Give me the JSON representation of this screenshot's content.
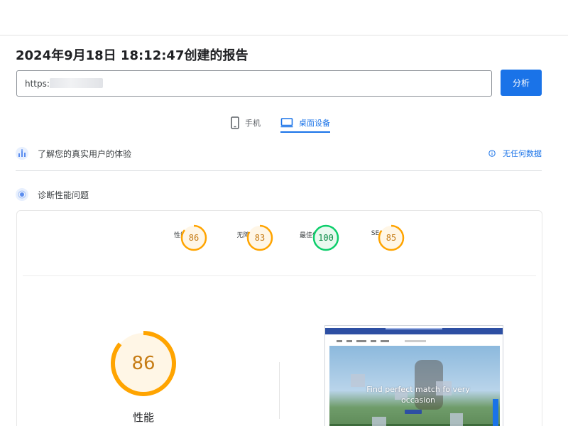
{
  "report": {
    "title": "2024年9月18日 18:12:47创建的报告"
  },
  "search": {
    "url_value": "https://          m/",
    "analyze_label": "分析"
  },
  "device_tabs": [
    {
      "label": "手机",
      "icon": "mobile-phone-icon",
      "active": false
    },
    {
      "label": "桌面设备",
      "icon": "desktop-monitor-icon",
      "active": true
    }
  ],
  "ux_section": {
    "label": "了解您的真实用户的体验",
    "icon": "crux-icon",
    "no_data_label": "无任何数据",
    "no_data_icon": "info-icon"
  },
  "diagnose_section": {
    "label": "诊断性能问题",
    "icon": "lighthouse-icon"
  },
  "scores": [
    {
      "value": "86",
      "label": "性能",
      "color": "#ffa400",
      "fraction": 0.86
    },
    {
      "value": "83",
      "label": "无障碍",
      "color": "#ffa400",
      "fraction": 0.83
    },
    {
      "value": "100",
      "label": "最佳做法",
      "color": "#0cce6b",
      "fraction": 1.0
    },
    {
      "value": "85",
      "label": "SEO",
      "color": "#ffa400",
      "fraction": 0.85
    }
  ],
  "main_score": {
    "value": "86",
    "label": "性能",
    "color": "#ffa400",
    "fraction": 0.86
  },
  "preview": {
    "headline": "Find   perfect   match fo  very occasion"
  },
  "colors": {
    "accent": "#1a73e8",
    "average": "#ffa400",
    "pass": "#0cce6b"
  }
}
